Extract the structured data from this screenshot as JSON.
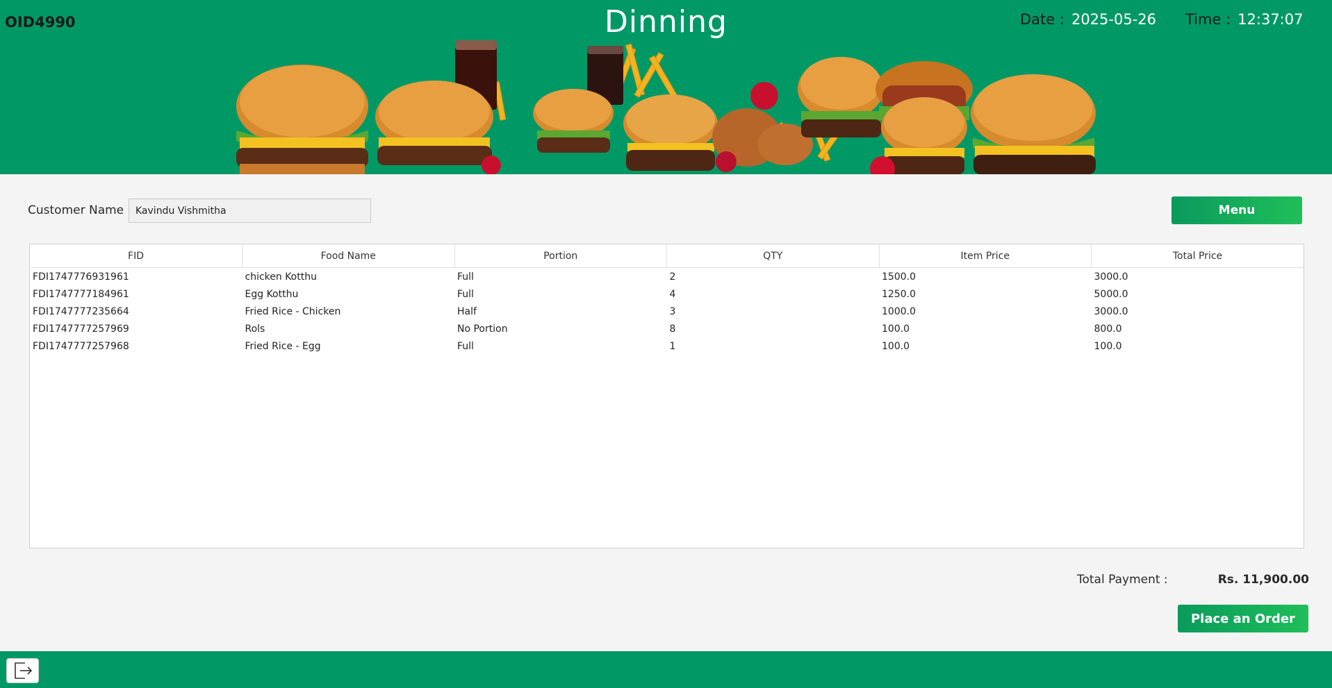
{
  "header": {
    "order_id": "OID4990",
    "title": "Dinning",
    "date_label": "Date :",
    "date_value": "2025-05-26",
    "time_label": "Time :",
    "time_value": "12:37:07",
    "banner_image": "burgers-and-fries-food-banner"
  },
  "form": {
    "customer_label": "Customer Name",
    "customer_value": "Kavindu Vishmitha",
    "menu_button": "Menu"
  },
  "table": {
    "columns": [
      "FID",
      "Food Name",
      "Portion",
      "QTY",
      "Item Price",
      "Total Price"
    ],
    "rows": [
      [
        "FDI1747776931961",
        "chicken Kotthu",
        "Full",
        "2",
        "1500.0",
        "3000.0"
      ],
      [
        "FDI1747777184961",
        "Egg Kotthu",
        "Full",
        "4",
        "1250.0",
        "5000.0"
      ],
      [
        "FDI1747777235664",
        "Fried Rice - Chicken",
        "Half",
        "3",
        "1000.0",
        "3000.0"
      ],
      [
        "FDI1747777257969",
        "Rols",
        "No Portion",
        "8",
        "100.0",
        "800.0"
      ],
      [
        "FDI1747777257968",
        "Fried Rice - Egg",
        "Full",
        "1",
        "100.0",
        "100.0"
      ]
    ]
  },
  "summary": {
    "total_label": "Total Payment :",
    "total_value": "Rs. 11,900.00",
    "place_order_button": "Place an Order"
  },
  "footer": {
    "exit_icon": "logout-icon"
  },
  "colors": {
    "brand_green": "#009966",
    "button_gradient_start": "#0a9a5c",
    "button_gradient_end": "#1fbf59",
    "background": "#f4f4f4"
  }
}
